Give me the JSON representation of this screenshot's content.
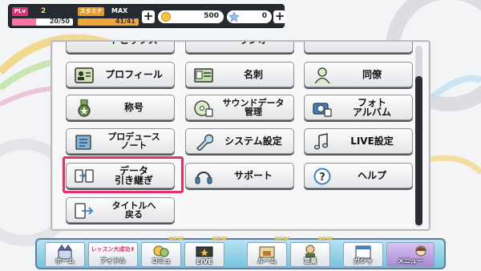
{
  "status": {
    "plv_label": "PLv",
    "plv": "2",
    "exp": "20/50",
    "exp_fill": 0.4,
    "stamina_label": "スタミナ",
    "stamina_max": "MAX",
    "stamina": "41/41",
    "stamina_fill": 1.0,
    "money": "500",
    "jewels": "0",
    "plus": "+"
  },
  "menu": {
    "partial_row": [
      "トピックス",
      "ラジオ",
      ""
    ],
    "buttons": [
      {
        "label": "プロフィール",
        "icon": "profile-card-icon"
      },
      {
        "label": "名刺",
        "icon": "business-card-icon"
      },
      {
        "label": "同僚",
        "icon": "colleagues-icon"
      },
      {
        "label": "称号",
        "icon": "medal-icon"
      },
      {
        "label": "サウンドデータ 管理",
        "icon": "sound-data-icon"
      },
      {
        "label": "フォト アルバム",
        "icon": "camera-icon"
      },
      {
        "label": "プロデュース ノート",
        "icon": "note-icon"
      },
      {
        "label": "システム設定",
        "icon": "wrench-icon"
      },
      {
        "label": "LIVE設定",
        "icon": "music-note-icon"
      },
      {
        "label": "データ 引き継ぎ",
        "icon": "data-transfer-icon"
      },
      {
        "label": "サポート",
        "icon": "headset-icon"
      },
      {
        "label": "ヘルプ",
        "icon": "question-icon"
      },
      {
        "label": "タイトルへ 戻る",
        "icon": "exit-icon"
      }
    ]
  },
  "nav": {
    "idol_banner": "レッスン大成功⬆",
    "new_tag": "NEW",
    "items": [
      {
        "label": "ホーム"
      },
      {
        "label": "アイドル"
      },
      {
        "label": "コミュ"
      },
      {
        "label": "LIVE"
      },
      {
        "label": "ルーム"
      },
      {
        "label": "営業"
      },
      {
        "label": "ガシャ"
      },
      {
        "label": "メニュー"
      }
    ]
  },
  "colors": {
    "highlight": "#e2306b",
    "accent_pink": "#ff72a4",
    "stamina_orange": "#f1a63b"
  }
}
